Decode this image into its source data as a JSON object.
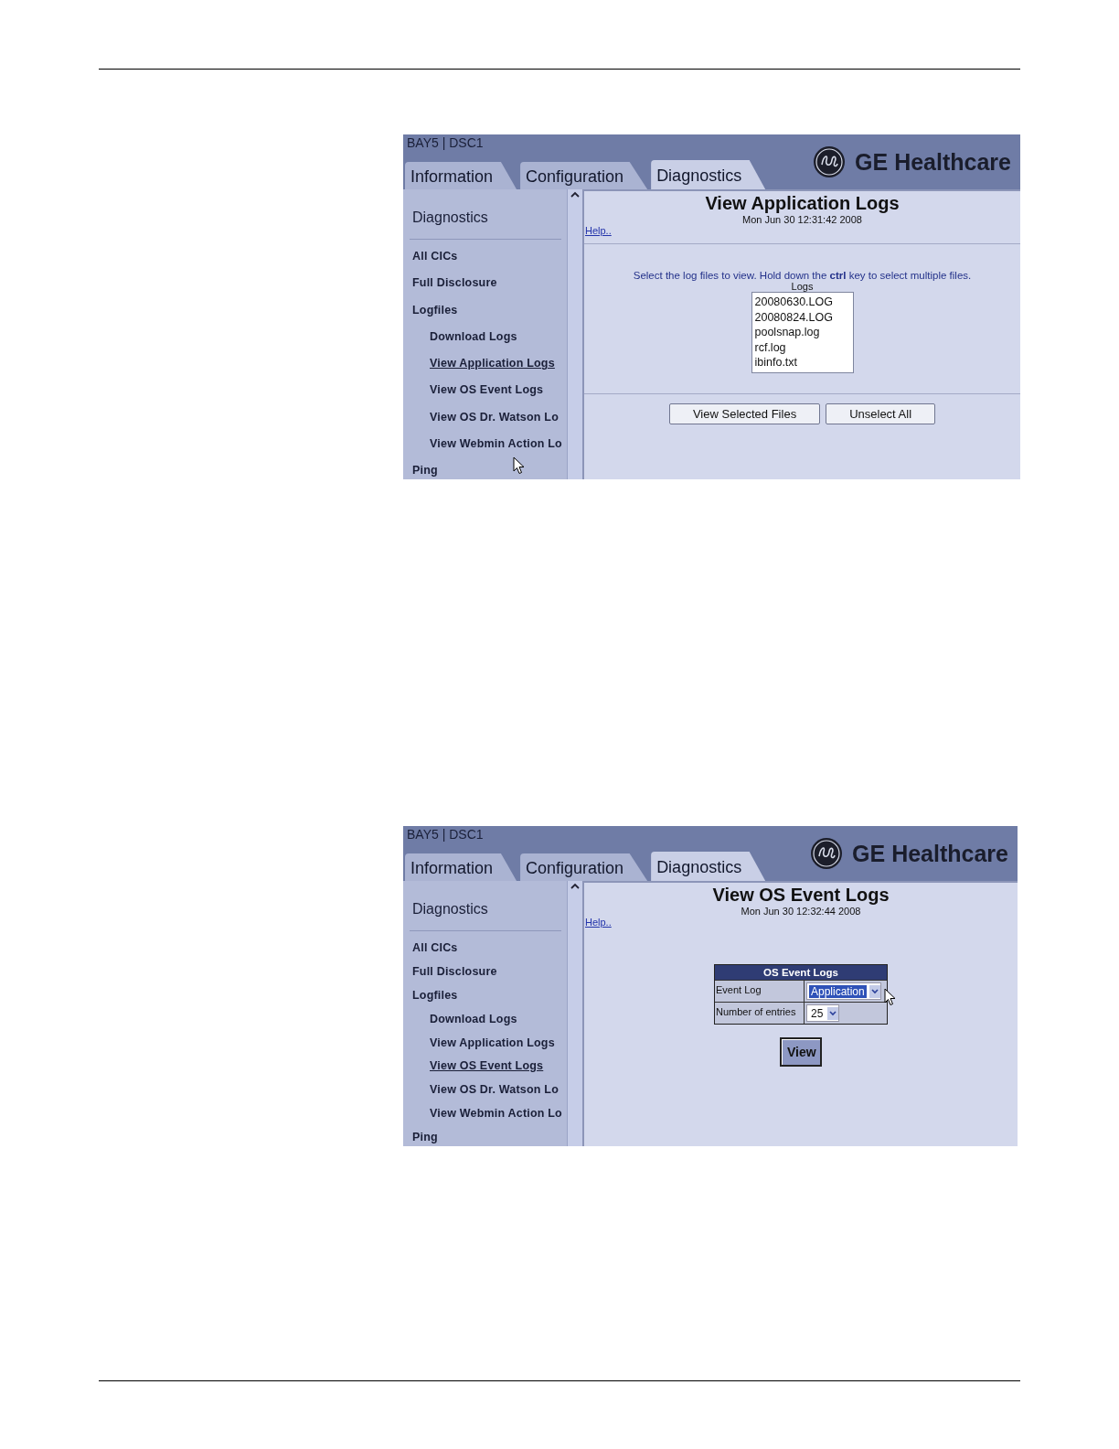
{
  "screens": [
    {
      "header": {
        "location": "BAY5 | DSC1",
        "brand": "GE Healthcare",
        "tabs": [
          {
            "label": "Information",
            "selected": false
          },
          {
            "label": "Configuration",
            "selected": false
          },
          {
            "label": "Diagnostics",
            "selected": true
          }
        ]
      },
      "sidebar": {
        "title": "Diagnostics",
        "items": [
          {
            "label": "All CICs",
            "selected": false
          },
          {
            "label": "Full Disclosure",
            "selected": false
          },
          {
            "label": "Logfiles",
            "selected": false,
            "children": [
              {
                "label": "Download Logs",
                "selected": false
              },
              {
                "label": "View Application Logs",
                "selected": true
              },
              {
                "label": "View OS Event Logs",
                "selected": false
              },
              {
                "label": "View OS Dr. Watson Lo",
                "selected": false
              },
              {
                "label": "View Webmin Action Lo",
                "selected": false
              }
            ]
          },
          {
            "label": "Ping",
            "selected": false
          }
        ]
      },
      "content": {
        "kind": "logs",
        "title": "View Application Logs",
        "timestamp": "Mon Jun 30 12:31:42 2008",
        "help": "Help..",
        "instruction": "Select the log files to view. Hold down the **ctrl** key to select multiple files.",
        "list_label": "Logs",
        "files": [
          "20080630.LOG",
          "20080824.LOG",
          "poolsnap.log",
          "rcf.log",
          "ibinfo.txt"
        ],
        "buttons": [
          "View Selected Files",
          "Unselect All"
        ]
      }
    },
    {
      "header": {
        "location": "BAY5 | DSC1",
        "brand": "GE Healthcare",
        "tabs": [
          {
            "label": "Information",
            "selected": false
          },
          {
            "label": "Configuration",
            "selected": false
          },
          {
            "label": "Diagnostics",
            "selected": true
          }
        ]
      },
      "sidebar": {
        "title": "Diagnostics",
        "items": [
          {
            "label": "All CICs",
            "selected": false
          },
          {
            "label": "Full Disclosure",
            "selected": false
          },
          {
            "label": "Logfiles",
            "selected": false,
            "children": [
              {
                "label": "Download Logs",
                "selected": false
              },
              {
                "label": "View Application Logs",
                "selected": false
              },
              {
                "label": "View OS Event Logs",
                "selected": true
              },
              {
                "label": "View OS Dr. Watson Lo",
                "selected": false
              },
              {
                "label": "View Webmin Action Lo",
                "selected": false
              }
            ]
          },
          {
            "label": "Ping",
            "selected": false
          }
        ]
      },
      "content": {
        "kind": "event",
        "title": "View OS Event Logs",
        "timestamp": "Mon Jun 30 12:32:44 2008",
        "help": "Help..",
        "form": {
          "title": "OS Event Logs",
          "rows": [
            {
              "label": "Event Log",
              "value": "Application",
              "selected": true
            },
            {
              "label": "Number of entries",
              "value": "25",
              "selected": false
            }
          ]
        },
        "buttons": [
          "View"
        ]
      }
    }
  ]
}
